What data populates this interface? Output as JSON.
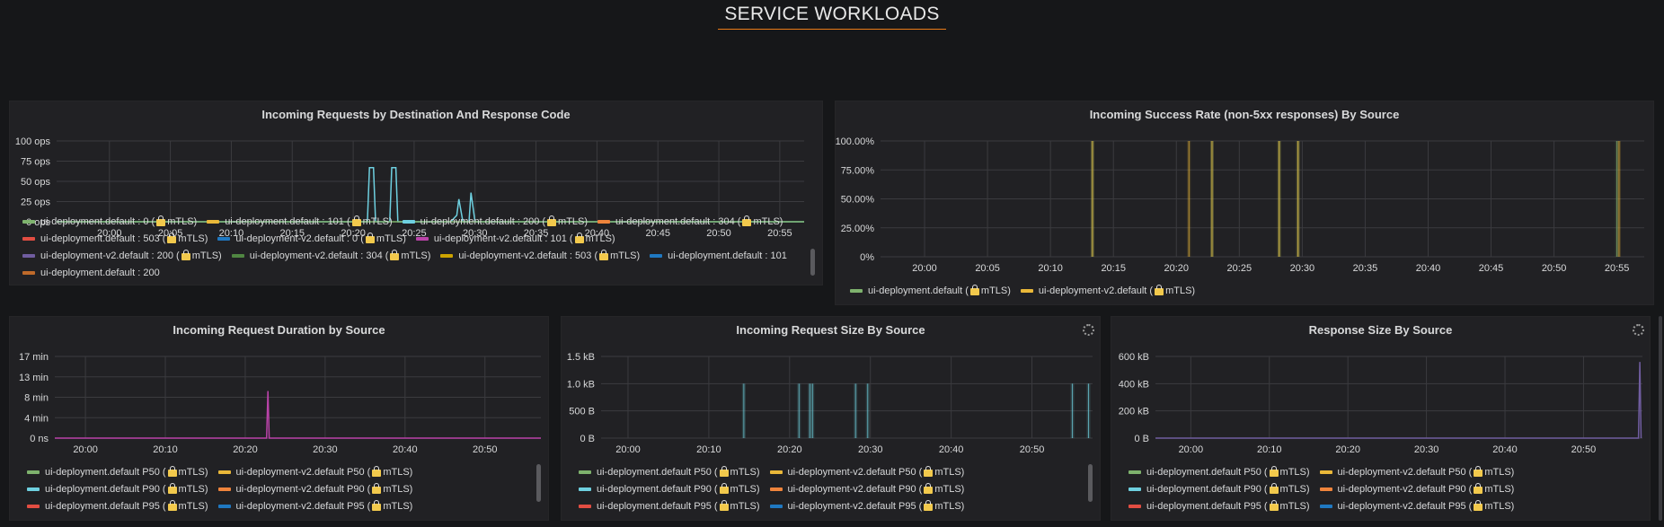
{
  "dashboard": {
    "row_title": "SERVICE WORKLOADS"
  },
  "colors": {
    "green": "#7eb26d",
    "yellow": "#eab839",
    "cyan": "#6ed0e0",
    "orange": "#ef843c",
    "red": "#e24d42",
    "blue": "#1f78c1",
    "magenta": "#ba43a9",
    "purple": "#705da0",
    "darkgreen": "#508642",
    "gold": "#cca300",
    "darkorange": "#bf6a2a"
  },
  "panels": {
    "requests": {
      "title": "Incoming Requests by Destination And Response Code",
      "legend": [
        {
          "text": "ui-deployment.default : 0 (",
          "suffix": "mTLS)",
          "lock": true,
          "color": "green"
        },
        {
          "text": "ui-deployment.default : 101 (",
          "suffix": "mTLS)",
          "lock": true,
          "color": "yellow"
        },
        {
          "text": "ui-deployment.default : 200 (",
          "suffix": "mTLS)",
          "lock": true,
          "color": "cyan"
        },
        {
          "text": "ui-deployment.default : 304 (",
          "suffix": "mTLS)",
          "lock": true,
          "color": "orange"
        },
        {
          "text": "ui-deployment.default : 503 (",
          "suffix": "mTLS)",
          "lock": true,
          "color": "red"
        },
        {
          "text": "ui-deployment-v2.default : 0 (",
          "suffix": "mTLS)",
          "lock": true,
          "color": "blue"
        },
        {
          "text": "ui-deployment-v2.default : 101 (",
          "suffix": "mTLS)",
          "lock": true,
          "color": "magenta"
        },
        {
          "text": "ui-deployment-v2.default : 200 (",
          "suffix": "mTLS)",
          "lock": true,
          "color": "purple"
        },
        {
          "text": "ui-deployment-v2.default : 304 (",
          "suffix": "mTLS)",
          "lock": true,
          "color": "darkgreen"
        },
        {
          "text": "ui-deployment-v2.default : 503 (",
          "suffix": "mTLS)",
          "lock": true,
          "color": "gold"
        },
        {
          "text": "ui-deployment.default : 101",
          "suffix": "",
          "lock": false,
          "color": "blue"
        },
        {
          "text": "ui-deployment.default : 200",
          "suffix": "",
          "lock": false,
          "color": "darkorange"
        }
      ]
    },
    "success": {
      "title": "Incoming Success Rate (non-5xx responses) By Source",
      "legend": [
        {
          "text": "ui-deployment.default (",
          "suffix": "mTLS)",
          "lock": true,
          "color": "green"
        },
        {
          "text": "ui-deployment-v2.default (",
          "suffix": "mTLS)",
          "lock": true,
          "color": "yellow"
        }
      ]
    },
    "duration": {
      "title": "Incoming Request Duration by Source"
    },
    "reqsize": {
      "title": "Incoming Request Size By Source"
    },
    "respsize": {
      "title": "Response Size By Source"
    }
  },
  "percentile_legend": [
    {
      "text": "ui-deployment.default P50 (",
      "suffix": "mTLS)",
      "lock": true,
      "color": "green"
    },
    {
      "text": "ui-deployment-v2.default P50 (",
      "suffix": "mTLS)",
      "lock": true,
      "color": "yellow"
    },
    {
      "text": "ui-deployment.default P90 (",
      "suffix": "mTLS)",
      "lock": true,
      "color": "cyan"
    },
    {
      "text": "ui-deployment-v2.default P90 (",
      "suffix": "mTLS)",
      "lock": true,
      "color": "orange"
    },
    {
      "text": "ui-deployment.default P95 (",
      "suffix": "mTLS)",
      "lock": true,
      "color": "red"
    },
    {
      "text": "ui-deployment-v2.default P95 (",
      "suffix": "mTLS)",
      "lock": true,
      "color": "blue"
    }
  ],
  "chart_data": [
    {
      "id": "requests",
      "type": "line",
      "title": "Incoming Requests by Destination And Response Code",
      "x_ticks": [
        "20:00",
        "20:05",
        "20:10",
        "20:15",
        "20:20",
        "20:25",
        "20:30",
        "20:35",
        "20:40",
        "20:45",
        "20:50",
        "20:55"
      ],
      "x_range": [
        "19:55:40",
        "20:57:00"
      ],
      "y_ticks": [
        "0 ops",
        "25 ops",
        "50 ops",
        "75 ops",
        "100 ops"
      ],
      "ylim": [
        0,
        100
      ],
      "series": [
        {
          "name": "ui-deployment.default : 200 (mTLS)",
          "color": "cyan",
          "points": [
            [
              "19:55:40",
              0
            ],
            [
              "20:21:10",
              0
            ],
            [
              "20:21:20",
              67
            ],
            [
              "20:21:40",
              67
            ],
            [
              "20:21:50",
              0
            ],
            [
              "20:23:00",
              0
            ],
            [
              "20:23:10",
              67
            ],
            [
              "20:23:30",
              67
            ],
            [
              "20:23:40",
              0
            ],
            [
              "20:28:00",
              0
            ],
            [
              "20:28:30",
              8
            ],
            [
              "20:28:40",
              28
            ],
            [
              "20:29:00",
              0
            ],
            [
              "20:29:30",
              0
            ],
            [
              "20:29:40",
              36
            ],
            [
              "20:30:00",
              0
            ],
            [
              "20:57:00",
              0
            ]
          ]
        },
        {
          "name": "ui-deployment.default : 0 (mTLS)",
          "color": "green",
          "points": [
            [
              "19:55:40",
              0
            ],
            [
              "20:57:00",
              0
            ]
          ]
        }
      ]
    },
    {
      "id": "success",
      "type": "line",
      "title": "Incoming Success Rate (non-5xx responses) By Source",
      "x_ticks": [
        "20:00",
        "20:05",
        "20:10",
        "20:15",
        "20:20",
        "20:25",
        "20:30",
        "20:35",
        "20:40",
        "20:45",
        "20:50",
        "20:55"
      ],
      "x_range": [
        "19:56:30",
        "20:57:10"
      ],
      "y_ticks": [
        "0%",
        "25.00%",
        "50.00%",
        "75.00%",
        "100.00%"
      ],
      "ylim": [
        0,
        100
      ],
      "series": [
        {
          "name": "ui-deployment.default (mTLS)",
          "color": "green",
          "spikes": [
            "20:13:20",
            "20:22:50",
            "20:28:10",
            "20:29:40",
            "20:55:00"
          ]
        },
        {
          "name": "ui-deployment-v2.default (mTLS)",
          "color": "yellow",
          "spikes": [
            "20:13:20",
            "20:21:00",
            "20:22:50",
            "20:28:10",
            "20:29:40",
            "20:55:10"
          ]
        }
      ]
    },
    {
      "id": "duration",
      "type": "line",
      "title": "Incoming Request Duration by Source",
      "x_ticks": [
        "20:00",
        "20:10",
        "20:20",
        "20:30",
        "20:40",
        "20:50"
      ],
      "x_range": [
        "19:56:10",
        "20:57:00"
      ],
      "y_ticks": [
        "0 ns",
        "4 min",
        "8 min",
        "13 min",
        "17 min"
      ],
      "ylim": [
        0,
        17
      ],
      "series": [
        {
          "name": "ui-deployment.default P50 (mTLS)",
          "color": "magenta",
          "points": [
            [
              "19:56:10",
              0
            ],
            [
              "20:22:40",
              0
            ],
            [
              "20:22:50",
              9.8
            ],
            [
              "20:23:00",
              0
            ],
            [
              "20:57:00",
              0
            ]
          ]
        }
      ]
    },
    {
      "id": "reqsize",
      "type": "line",
      "title": "Incoming Request Size By Source",
      "x_ticks": [
        "20:00",
        "20:10",
        "20:20",
        "20:30",
        "20:40",
        "20:50"
      ],
      "x_range": [
        "19:56:40",
        "20:57:30"
      ],
      "y_ticks": [
        "0 B",
        "500 B",
        "1.0 kB",
        "1.5 kB"
      ],
      "ylim": [
        0,
        1500
      ],
      "series": [
        {
          "name": "ui-deployment.default P50 (mTLS)",
          "color": "cyan",
          "spikes": [
            "20:14:20",
            "20:21:10",
            "20:22:30",
            "20:22:50",
            "20:28:10",
            "20:29:40",
            "20:55:00",
            "20:57:00"
          ],
          "spike_value": 1000
        }
      ]
    },
    {
      "id": "respsize",
      "type": "line",
      "title": "Response Size By Source",
      "x_ticks": [
        "20:00",
        "20:10",
        "20:20",
        "20:30",
        "20:40",
        "20:50"
      ],
      "x_range": [
        "19:55:30",
        "20:57:30"
      ],
      "y_ticks": [
        "0 B",
        "200 kB",
        "400 kB",
        "600 kB"
      ],
      "ylim": [
        0,
        600
      ],
      "series": [
        {
          "name": "ui-deployment-v2.default P95 (mTLS)",
          "color": "purple",
          "points": [
            [
              "19:55:30",
              0
            ],
            [
              "20:57:00",
              0
            ],
            [
              "20:57:10",
              560
            ],
            [
              "20:57:20",
              0
            ]
          ]
        }
      ]
    }
  ]
}
